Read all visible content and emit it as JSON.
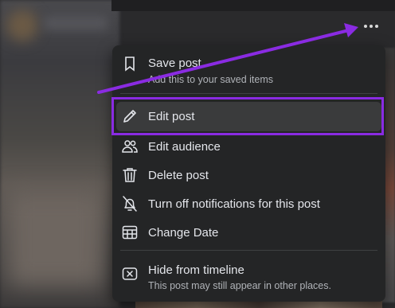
{
  "colors": {
    "menu_bg": "#242526",
    "text_primary": "#e4e6eb",
    "text_secondary": "#b0b3b8",
    "annotation": "#8a2be2"
  },
  "more_button": {
    "icon": "more-horizontal-icon"
  },
  "menu": {
    "save_post": {
      "label": "Save post",
      "subtext": "Add this to your saved items",
      "icon": "bookmark-icon"
    },
    "edit_post": {
      "label": "Edit post",
      "icon": "pencil-icon"
    },
    "edit_audience": {
      "label": "Edit audience",
      "icon": "people-icon"
    },
    "delete_post": {
      "label": "Delete post",
      "icon": "trash-icon"
    },
    "turn_off_notifications": {
      "label": "Turn off notifications for this post",
      "icon": "bell-off-icon"
    },
    "change_date": {
      "label": "Change Date",
      "icon": "calendar-icon"
    },
    "hide_from_timeline": {
      "label": "Hide from timeline",
      "subtext": "This post may still appear in other places.",
      "icon": "close-box-icon"
    }
  }
}
